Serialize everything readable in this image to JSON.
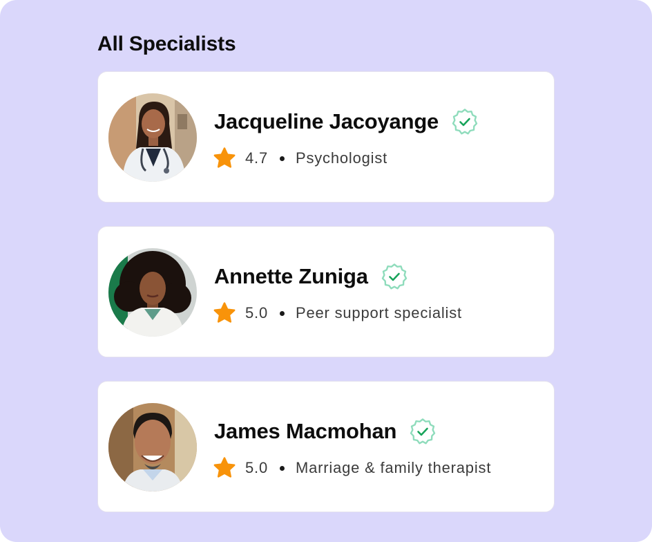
{
  "theme": {
    "background": "#dad7fb",
    "card_background": "#ffffff",
    "verified_color": "#2fbf6f",
    "star_color": "#f8930a"
  },
  "section": {
    "title": "All Specialists"
  },
  "specialists": [
    {
      "name": "Jacqueline Jacoyange",
      "rating": "4.7",
      "role": "Psychologist",
      "avatar_icon": "doctor-woman-avatar",
      "verified_icon": "verified-badge-icon",
      "rating_icon": "star-icon"
    },
    {
      "name": "Annette Zuniga",
      "rating": "5.0",
      "role": "Peer support specialist",
      "avatar_icon": "woman-curly-hair-avatar",
      "verified_icon": "verified-badge-icon",
      "rating_icon": "star-icon"
    },
    {
      "name": "James Macmohan",
      "rating": "5.0",
      "role": "Marriage & family therapist",
      "avatar_icon": "smiling-man-avatar",
      "verified_icon": "verified-badge-icon",
      "rating_icon": "star-icon"
    }
  ]
}
